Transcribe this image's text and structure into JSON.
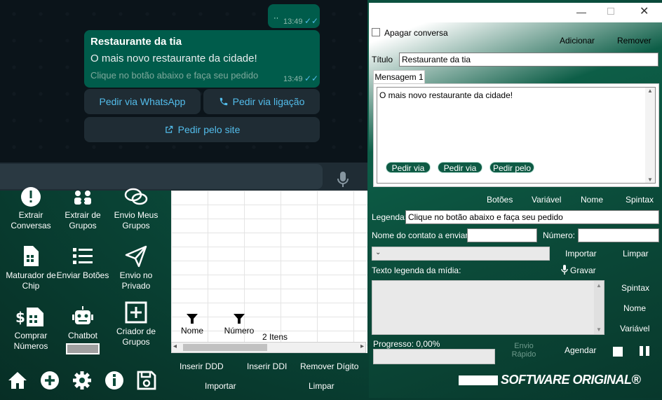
{
  "whatsapp": {
    "top_bubble": {
      "text": "··",
      "time": "13:49"
    },
    "message": {
      "title": "Restaurante da tia",
      "body": "O mais novo restaurante da cidade!",
      "footer": "Clique no botão abaixo e faça seu pedido",
      "time": "13:49"
    },
    "buttons": [
      "Pedir via WhatsApp",
      "Pedir via ligação",
      "Pedir pelo site"
    ]
  },
  "tools": [
    {
      "label": "Extrair Conversas",
      "icon": "alert-circle-icon"
    },
    {
      "label": "Extrair de Grupos",
      "icon": "group-extract-icon"
    },
    {
      "label": "Envio Meus Grupos",
      "icon": "chat-bubbles-icon"
    },
    {
      "label": "Maturador de Chip",
      "icon": "sim-card-icon"
    },
    {
      "label": "Enviar Botões",
      "icon": "list-icon"
    },
    {
      "label": "Envio no Privado",
      "icon": "send-icon"
    },
    {
      "label": "Comprar Números",
      "icon": "buy-numbers-icon"
    },
    {
      "label": "Chatbot",
      "icon": "robot-icon"
    },
    {
      "label": "Criador de Grupos",
      "icon": "plus-box-icon"
    }
  ],
  "bottom_nav": [
    "home-icon",
    "add-circle-icon",
    "settings-icon",
    "info-icon",
    "save-icon"
  ],
  "grid": {
    "filter_nome": "Nome",
    "filter_numero": "Número",
    "item_count": "2 Itens",
    "actions": {
      "inserir_ddd": "Inserir DDD",
      "inserir_ddi": "Inserir DDI",
      "remover_digito": "Remover Dígito",
      "importar": "Importar",
      "limpar": "Limpar"
    }
  },
  "dialog": {
    "apagar_conversa": "Apagar conversa",
    "adicionar": "Adicionar",
    "remover": "Remover",
    "titulo_label": "Título",
    "titulo_value": "Restaurante da tia",
    "tab_mensagem": "Mensagem 1",
    "message_text": "O mais novo restaurante da cidade!",
    "pills": [
      "Pedir via",
      "Pedir via",
      "Pedir pelo"
    ],
    "insert_buttons": [
      "Botões",
      "Variável",
      "Nome",
      "Spintax"
    ],
    "legenda_label": "Legenda:",
    "legenda_value": "Clique no botão abaixo e faça seu pedido",
    "nome_contato_label": "Nome do contato a enviar:",
    "numero_label": "Número:",
    "importar": "Importar",
    "limpar": "Limpar",
    "texto_legenda_label": "Texto legenda da mídia:",
    "gravar": "Gravar",
    "side_buttons": [
      "Spintax",
      "Nome",
      "Variável"
    ],
    "progresso": "Progresso: 0,00%",
    "envio_rapido": "Envio Rápido",
    "agendar": "Agendar",
    "brand": "SOFTWARE ORIGINAL®"
  },
  "colors": {
    "accent": "#0e5a44",
    "wa_link": "#53bdeb",
    "wa_bubble": "#005c4b"
  }
}
